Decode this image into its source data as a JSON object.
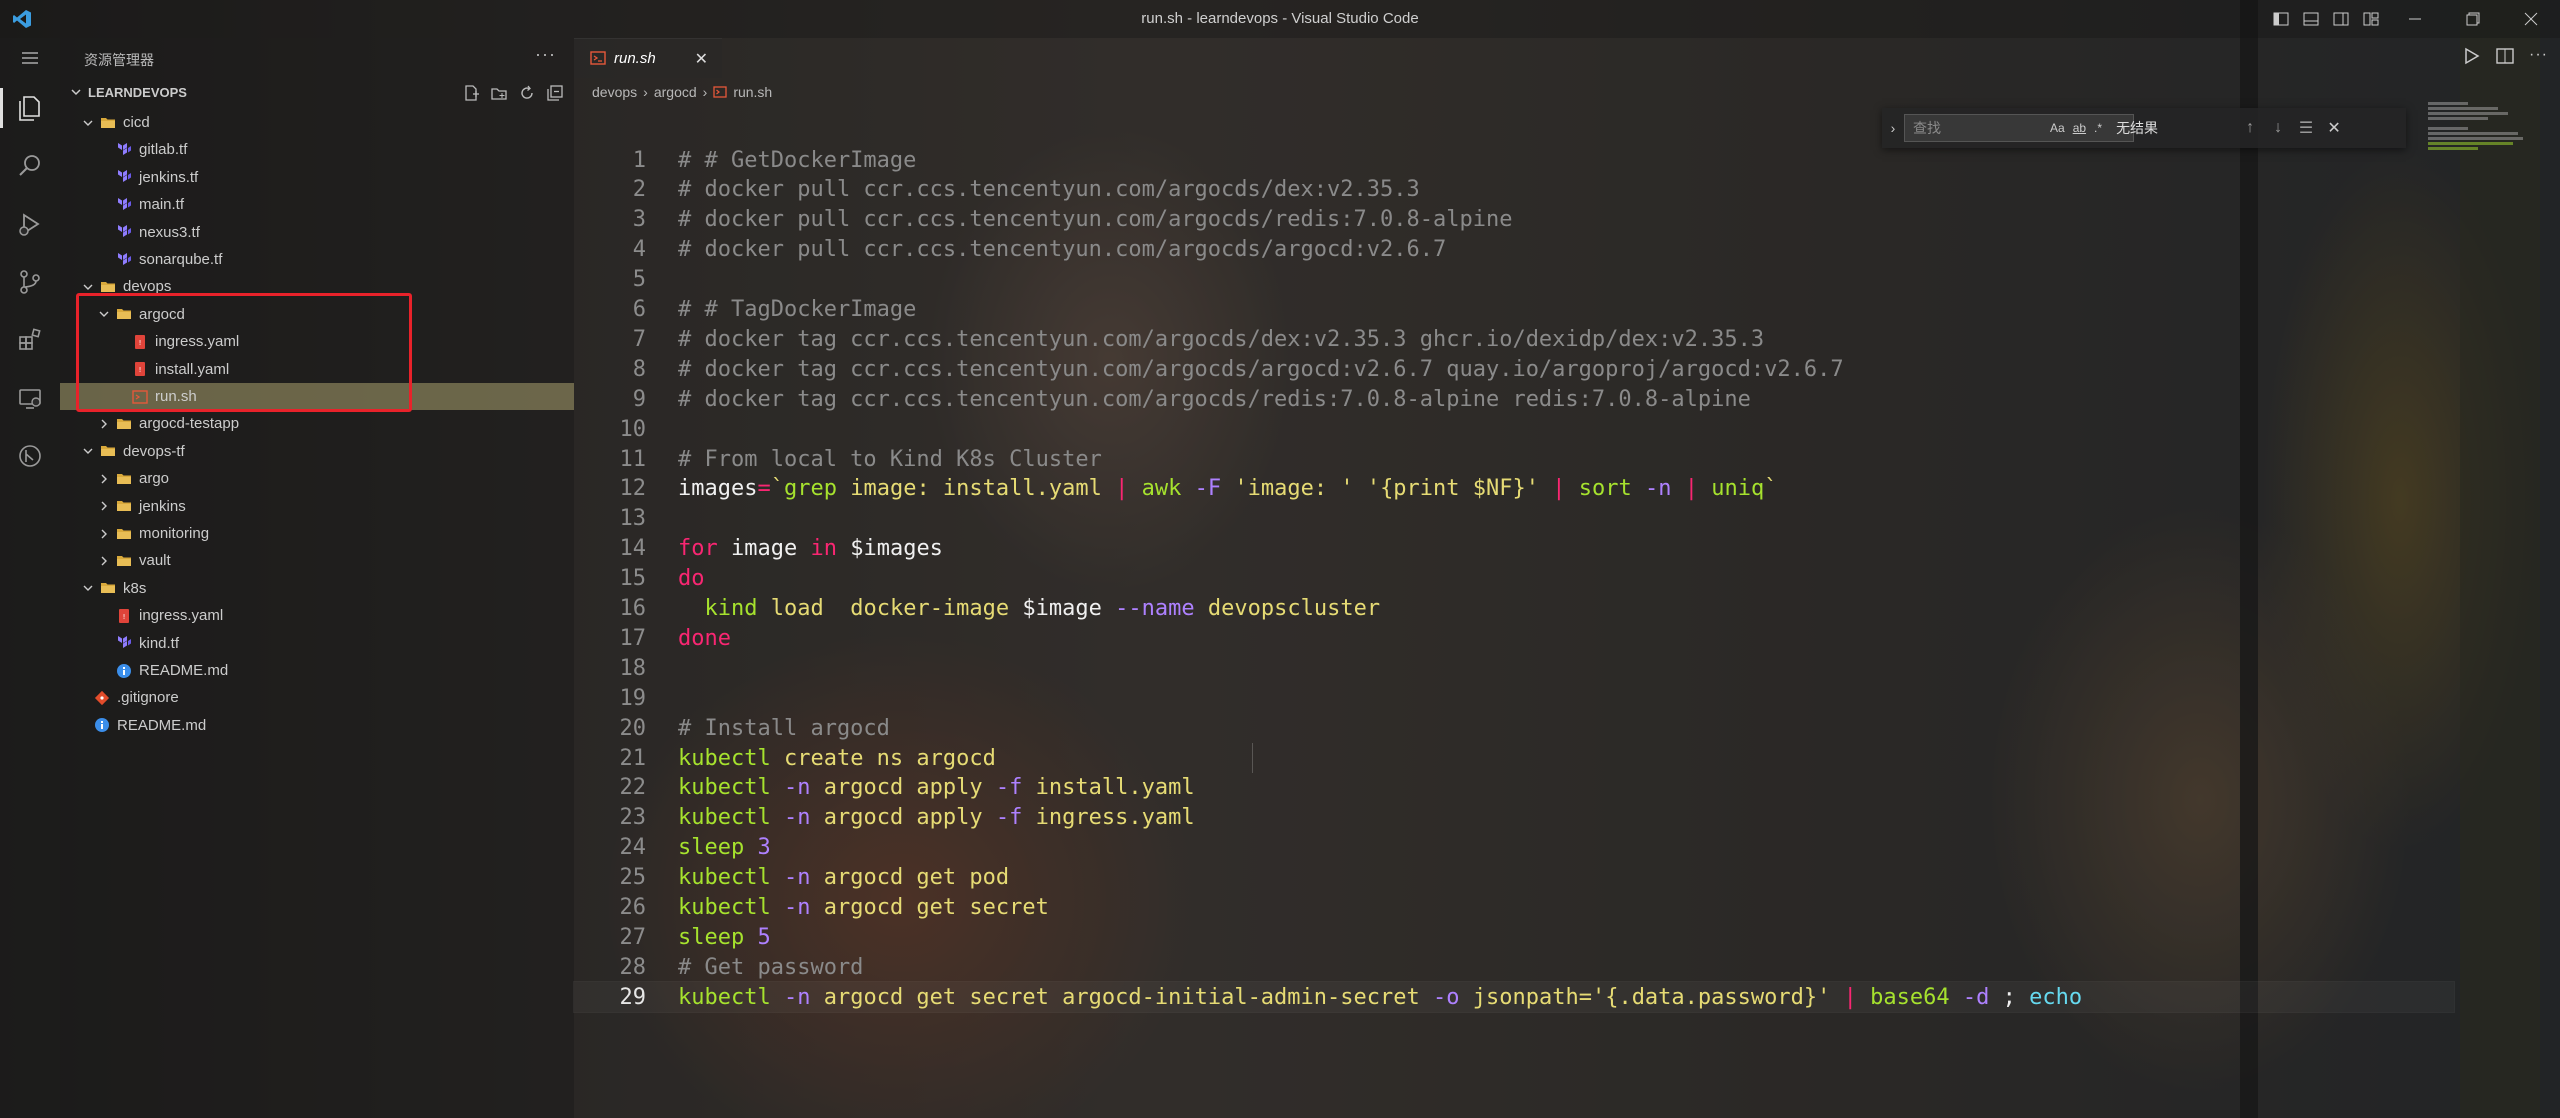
{
  "window": {
    "title": "run.sh - learndevops - Visual Studio Code"
  },
  "sidebar": {
    "title": "资源管理器",
    "section": "LEARNDEVOPS",
    "tree": [
      {
        "label": "cicd",
        "type": "folder",
        "depth": 0,
        "expanded": true
      },
      {
        "label": "gitlab.tf",
        "type": "terraform",
        "depth": 1
      },
      {
        "label": "jenkins.tf",
        "type": "terraform",
        "depth": 1
      },
      {
        "label": "main.tf",
        "type": "terraform",
        "depth": 1
      },
      {
        "label": "nexus3.tf",
        "type": "terraform",
        "depth": 1
      },
      {
        "label": "sonarqube.tf",
        "type": "terraform",
        "depth": 1
      },
      {
        "label": "devops",
        "type": "folder",
        "depth": 0,
        "expanded": true
      },
      {
        "label": "argocd",
        "type": "folder",
        "depth": 1,
        "expanded": true
      },
      {
        "label": "ingress.yaml",
        "type": "yaml",
        "depth": 2
      },
      {
        "label": "install.yaml",
        "type": "yaml",
        "depth": 2
      },
      {
        "label": "run.sh",
        "type": "shell",
        "depth": 2,
        "selected": true
      },
      {
        "label": "argocd-testapp",
        "type": "folder",
        "depth": 1,
        "expanded": false
      },
      {
        "label": "devops-tf",
        "type": "folder",
        "depth": 0,
        "expanded": true
      },
      {
        "label": "argo",
        "type": "folder",
        "depth": 1,
        "expanded": false
      },
      {
        "label": "jenkins",
        "type": "folder",
        "depth": 1,
        "expanded": false
      },
      {
        "label": "monitoring",
        "type": "folder",
        "depth": 1,
        "expanded": false
      },
      {
        "label": "vault",
        "type": "folder",
        "depth": 1,
        "expanded": false
      },
      {
        "label": "k8s",
        "type": "folder",
        "depth": 0,
        "expanded": true
      },
      {
        "label": "ingress.yaml",
        "type": "yaml",
        "depth": 1
      },
      {
        "label": "kind.tf",
        "type": "terraform",
        "depth": 1
      },
      {
        "label": "README.md",
        "type": "info",
        "depth": 1
      },
      {
        "label": ".gitignore",
        "type": "git",
        "depth": 0
      },
      {
        "label": "README.md",
        "type": "info",
        "depth": 0
      }
    ]
  },
  "tab": {
    "label": "run.sh"
  },
  "breadcrumb": [
    "devops",
    "argocd",
    "run.sh"
  ],
  "find": {
    "placeholder": "查找",
    "opt_case": "Aa",
    "opt_word": "ab",
    "opt_regex": ".*",
    "result": "无结果"
  },
  "colors": {
    "selection": "#aaa06e",
    "highlight_box": "#e8222a",
    "keyword": "#f92672",
    "function": "#a6e22e",
    "string": "#e6db74"
  },
  "editor": {
    "current_line": 29,
    "lines": [
      [
        [
          "c-comment",
          "# # GetDockerImage"
        ]
      ],
      [
        [
          "c-comment",
          "# docker pull ccr.ccs.tencentyun.com/argocds/dex:v2.35.3"
        ]
      ],
      [
        [
          "c-comment",
          "# docker pull ccr.ccs.tencentyun.com/argocds/redis:7.0.8-alpine"
        ]
      ],
      [
        [
          "c-comment",
          "# docker pull ccr.ccs.tencentyun.com/argocds/argocd:v2.6.7"
        ]
      ],
      [],
      [
        [
          "c-comment",
          "# # TagDockerImage"
        ]
      ],
      [
        [
          "c-comment",
          "# docker tag ccr.ccs.tencentyun.com/argocds/dex:v2.35.3 ghcr.io/dexidp/dex:v2.35.3"
        ]
      ],
      [
        [
          "c-comment",
          "# docker tag ccr.ccs.tencentyun.com/argocds/argocd:v2.6.7 quay.io/argoproj/argocd:v2.6.7"
        ]
      ],
      [
        [
          "c-comment",
          "# docker tag ccr.ccs.tencentyun.com/argocds/redis:7.0.8-alpine redis:7.0.8-alpine"
        ]
      ],
      [],
      [
        [
          "c-comment",
          "# From local to Kind K8s Cluster"
        ]
      ],
      [
        [
          "c-plain",
          "images"
        ],
        [
          "c-kw",
          "="
        ],
        [
          "c-str",
          "`"
        ],
        [
          "c-fn",
          "grep"
        ],
        [
          "c-str",
          " image: install.yaml "
        ],
        [
          "c-kw",
          "|"
        ],
        [
          "c-str",
          " "
        ],
        [
          "c-fn",
          "awk"
        ],
        [
          "c-str",
          " "
        ],
        [
          "c-op",
          "-F"
        ],
        [
          "c-str",
          " 'image: ' '{print $NF}' "
        ],
        [
          "c-kw",
          "|"
        ],
        [
          "c-str",
          " "
        ],
        [
          "c-fn",
          "sort"
        ],
        [
          "c-str",
          " "
        ],
        [
          "c-op",
          "-n"
        ],
        [
          "c-str",
          " "
        ],
        [
          "c-kw",
          "|"
        ],
        [
          "c-str",
          " "
        ],
        [
          "c-fn",
          "uniq"
        ],
        [
          "c-str",
          "`"
        ]
      ],
      [],
      [
        [
          "c-kw",
          "for"
        ],
        [
          "c-plain",
          " image "
        ],
        [
          "c-kw",
          "in"
        ],
        [
          "c-plain",
          " $images"
        ]
      ],
      [
        [
          "c-kw",
          "do"
        ]
      ],
      [
        [
          "c-plain",
          "  "
        ],
        [
          "c-fn",
          "kind"
        ],
        [
          "c-plain",
          " "
        ],
        [
          "c-str",
          "load"
        ],
        [
          "c-plain",
          "  "
        ],
        [
          "c-str",
          "docker-image"
        ],
        [
          "c-plain",
          " $image "
        ],
        [
          "c-op",
          "--name"
        ],
        [
          "c-plain",
          " "
        ],
        [
          "c-str",
          "devopscluster"
        ]
      ],
      [
        [
          "c-kw",
          "done"
        ]
      ],
      [],
      [],
      [
        [
          "c-comment",
          "# Install argocd"
        ]
      ],
      [
        [
          "c-fn",
          "kubectl"
        ],
        [
          "c-plain",
          " "
        ],
        [
          "c-str",
          "create ns argocd"
        ]
      ],
      [
        [
          "c-fn",
          "kubectl"
        ],
        [
          "c-plain",
          " "
        ],
        [
          "c-op",
          "-n"
        ],
        [
          "c-plain",
          " "
        ],
        [
          "c-str",
          "argocd apply"
        ],
        [
          "c-plain",
          " "
        ],
        [
          "c-op",
          "-f"
        ],
        [
          "c-plain",
          " "
        ],
        [
          "c-str",
          "install.yaml"
        ]
      ],
      [
        [
          "c-fn",
          "kubectl"
        ],
        [
          "c-plain",
          " "
        ],
        [
          "c-op",
          "-n"
        ],
        [
          "c-plain",
          " "
        ],
        [
          "c-str",
          "argocd apply"
        ],
        [
          "c-plain",
          " "
        ],
        [
          "c-op",
          "-f"
        ],
        [
          "c-plain",
          " "
        ],
        [
          "c-str",
          "ingress.yaml"
        ]
      ],
      [
        [
          "c-fn",
          "sleep"
        ],
        [
          "c-plain",
          " "
        ],
        [
          "c-op",
          "3"
        ]
      ],
      [
        [
          "c-fn",
          "kubectl"
        ],
        [
          "c-plain",
          " "
        ],
        [
          "c-op",
          "-n"
        ],
        [
          "c-plain",
          " "
        ],
        [
          "c-str",
          "argocd get pod"
        ]
      ],
      [
        [
          "c-fn",
          "kubectl"
        ],
        [
          "c-plain",
          " "
        ],
        [
          "c-op",
          "-n"
        ],
        [
          "c-plain",
          " "
        ],
        [
          "c-str",
          "argocd get secret"
        ]
      ],
      [
        [
          "c-fn",
          "sleep"
        ],
        [
          "c-plain",
          " "
        ],
        [
          "c-op",
          "5"
        ]
      ],
      [
        [
          "c-comment",
          "# Get password"
        ]
      ],
      [
        [
          "c-fn",
          "kubectl"
        ],
        [
          "c-plain",
          " "
        ],
        [
          "c-op",
          "-n"
        ],
        [
          "c-plain",
          " "
        ],
        [
          "c-str",
          "argocd get secret argocd-initial-admin-secret"
        ],
        [
          "c-plain",
          " "
        ],
        [
          "c-op",
          "-o"
        ],
        [
          "c-plain",
          " "
        ],
        [
          "c-str",
          "jsonpath='{.data.password}'"
        ],
        [
          "c-plain",
          " "
        ],
        [
          "c-kw",
          "|"
        ],
        [
          "c-plain",
          " "
        ],
        [
          "c-fn",
          "base64"
        ],
        [
          "c-plain",
          " "
        ],
        [
          "c-op",
          "-d"
        ],
        [
          "c-plain",
          " ; "
        ],
        [
          "c-echo",
          "echo"
        ]
      ]
    ]
  }
}
